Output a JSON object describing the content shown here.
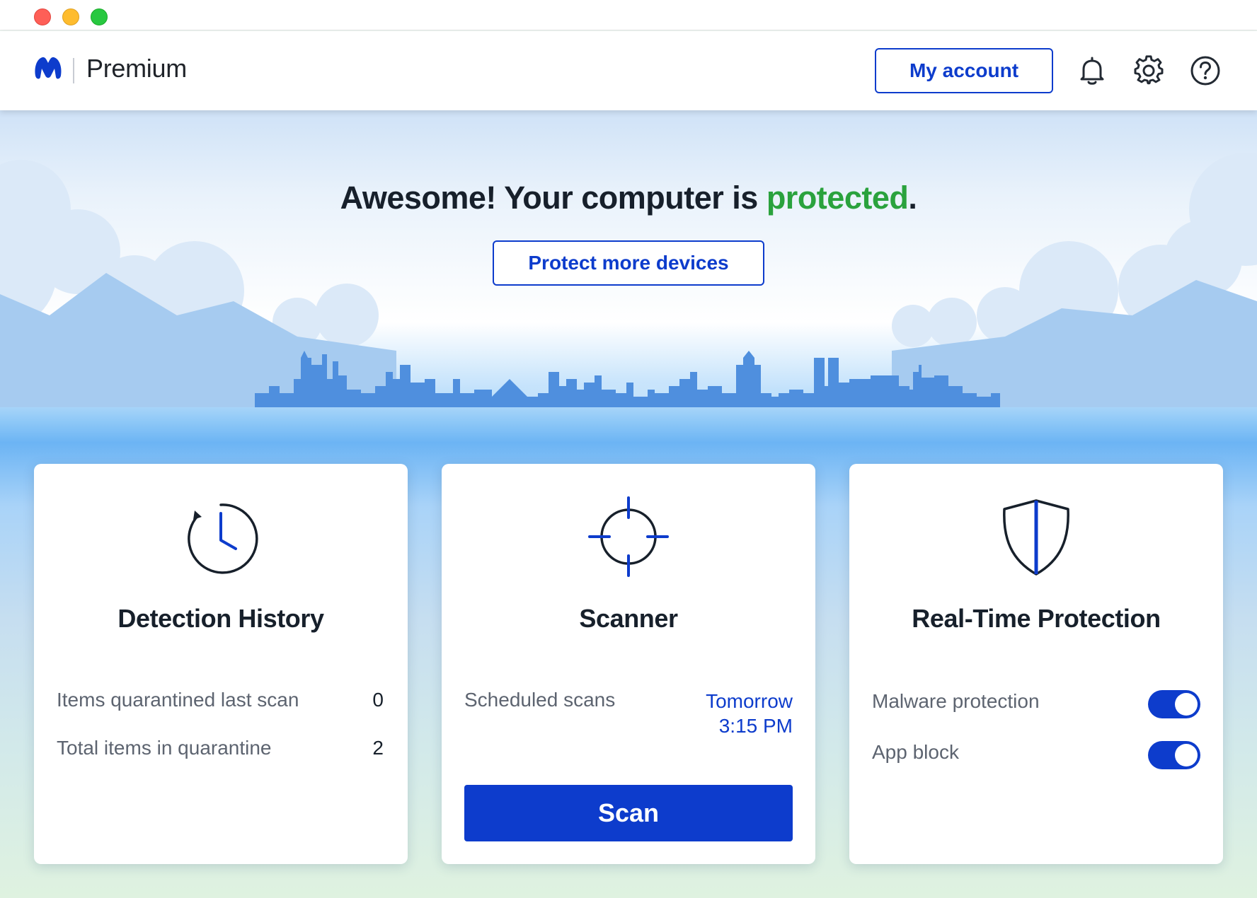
{
  "window": {
    "controls": [
      "close",
      "minimize",
      "zoom"
    ]
  },
  "header": {
    "product_name": "Premium",
    "account_label": "My account",
    "icons": [
      "bell-icon",
      "gear-icon",
      "help-icon"
    ]
  },
  "hero": {
    "headline_prefix": "Awesome! Your computer is ",
    "headline_status": "protected",
    "headline_suffix": ".",
    "protect_button": "Protect more devices"
  },
  "cards": {
    "detection": {
      "title": "Detection History",
      "icon": "clock-history-icon",
      "rows": [
        {
          "label": "Items quarantined last scan",
          "value": "0"
        },
        {
          "label": "Total items in quarantine",
          "value": "2"
        }
      ]
    },
    "scanner": {
      "title": "Scanner",
      "icon": "crosshair-icon",
      "scheduled_label": "Scheduled scans",
      "scheduled_day": "Tomorrow",
      "scheduled_time": "3:15 PM",
      "scan_button": "Scan"
    },
    "realtime": {
      "title": "Real-Time Protection",
      "icon": "shield-icon",
      "toggles": [
        {
          "label": "Malware protection",
          "on": true
        },
        {
          "label": "App block",
          "on": true
        }
      ]
    }
  },
  "colors": {
    "accent": "#0d3ccc",
    "status_ok": "#2aa23d",
    "text_primary": "#17202b",
    "text_secondary": "#5d6470"
  }
}
